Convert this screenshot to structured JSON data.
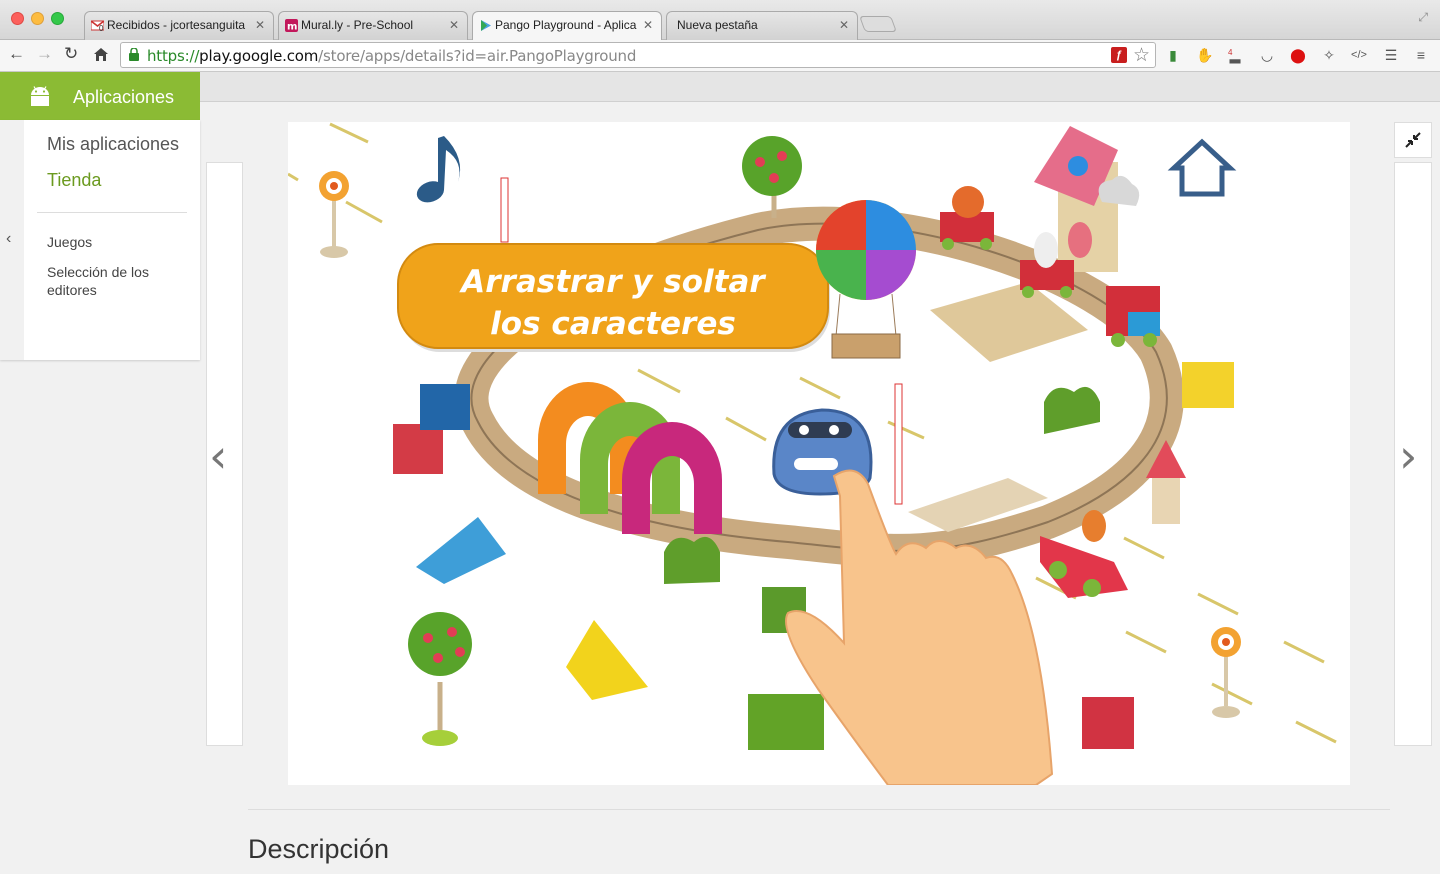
{
  "browser": {
    "tabs": [
      {
        "label": "Recibidos - jcortesanguita",
        "favicon": "gmail-icon"
      },
      {
        "label": "Mural.ly - Pre-School",
        "favicon": "murally-icon"
      },
      {
        "label": "Pango Playground - Aplica",
        "favicon": "play-store-icon",
        "active": true
      },
      {
        "label": "Nueva pestaña",
        "favicon": ""
      }
    ],
    "gmail_badge": "0",
    "url_scheme": "https://",
    "url_host": "play.google.com",
    "url_path": "/store/apps/details?id=air.PangoPlayground",
    "extension_badge": "4"
  },
  "sidebar": {
    "category": "Aplicaciones",
    "my_apps": "Mis aplicaciones",
    "store": "Tienda",
    "games": "Juegos",
    "editors_choice": "Selección de los editores"
  },
  "lightbox": {
    "banner_line1": "Arrastrar y soltar",
    "banner_line2": "los caracteres"
  },
  "description": {
    "title": "Descripción"
  },
  "colors": {
    "play_green": "#8bbb34",
    "banner_orange": "#f0a31a"
  }
}
